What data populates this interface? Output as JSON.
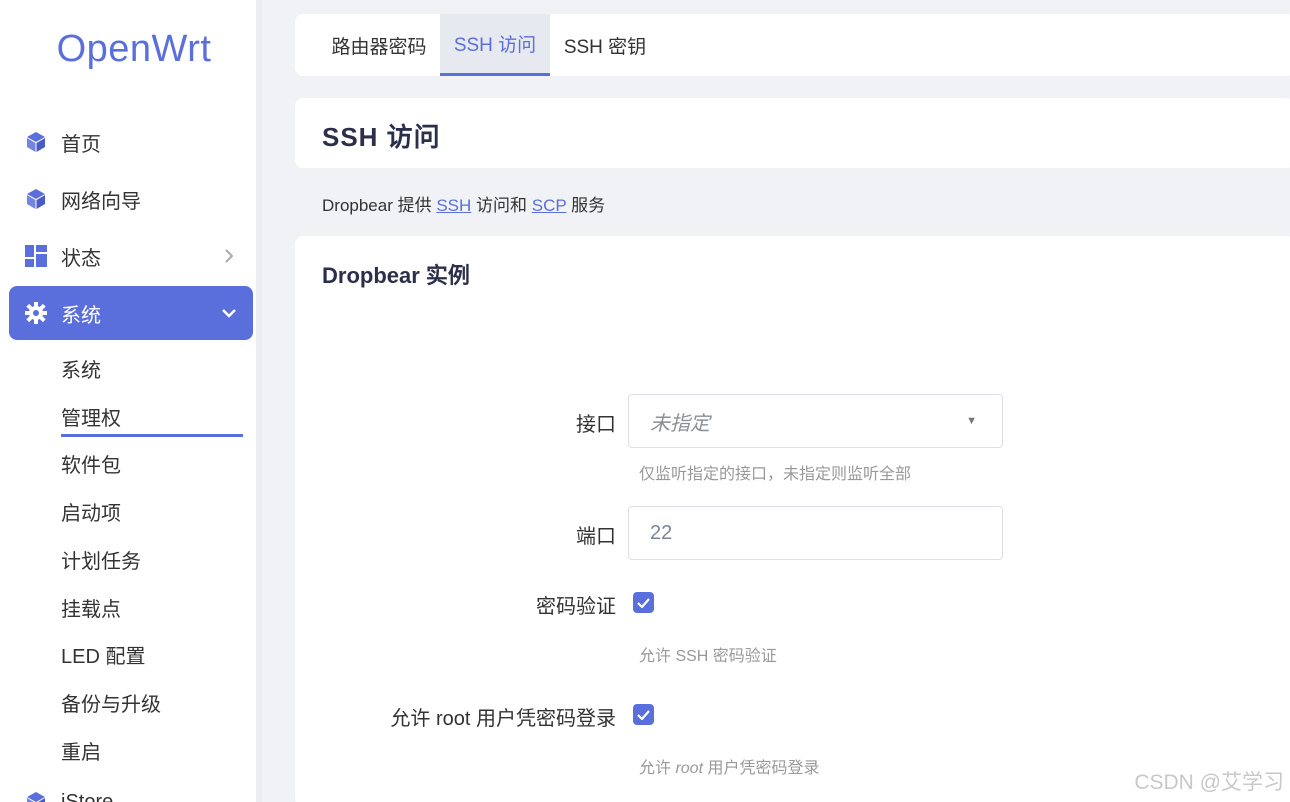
{
  "app": {
    "logo": "OpenWrt"
  },
  "sidebar": {
    "items": [
      {
        "label": "首页",
        "icon": "cube-icon"
      },
      {
        "label": "网络向导",
        "icon": "cube-icon"
      },
      {
        "label": "状态",
        "icon": "dashboard-icon"
      },
      {
        "label": "系统",
        "icon": "gear-icon"
      }
    ],
    "sub_items": [
      "系统",
      "管理权",
      "软件包",
      "启动项",
      "计划任务",
      "挂载点",
      "LED 配置",
      "备份与升级",
      "重启"
    ],
    "next_item": {
      "label": "iStore",
      "icon": "cube-icon"
    }
  },
  "tabs": [
    "路由器密码",
    "SSH 访问",
    "SSH 密钥"
  ],
  "page": {
    "title": "SSH 访问",
    "description": {
      "before": "Dropbear 提供 ",
      "link1": "SSH",
      "middle": " 访问和 ",
      "link2": "SCP",
      "after": " 服务"
    }
  },
  "section": {
    "title": "Dropbear 实例",
    "interface": {
      "label": "接口",
      "placeholder": "未指定",
      "hint": "仅监听指定的接口，未指定则监听全部"
    },
    "port": {
      "label": "端口",
      "value": "22"
    },
    "password_auth": {
      "label": "密码验证",
      "checked": true,
      "hint": "允许 SSH 密码验证"
    },
    "root_password": {
      "label": "允许 root 用户凭密码登录",
      "checked": true,
      "hint_root": "root",
      "hint_before": "允许 ",
      "hint_after": " 用户凭密码登录"
    }
  },
  "watermark": "CSDN @艾学习",
  "colors": {
    "accent": "#5b6fdc",
    "background": "#f1f2f5"
  }
}
